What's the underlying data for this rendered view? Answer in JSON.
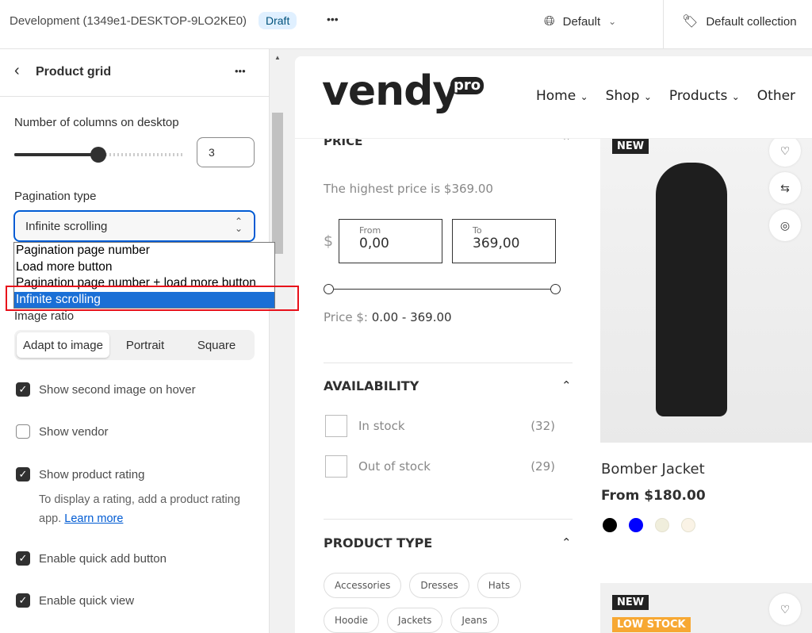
{
  "topbar": {
    "title": "Development (1349e1-DESKTOP-9LO2KE0)",
    "badge": "Draft",
    "more": "•••",
    "language": "Default",
    "collection": "Default collection"
  },
  "panel": {
    "back": "‹",
    "title": "Product grid",
    "more": "•••",
    "columns_label": "Number of columns on desktop",
    "columns_value": "3",
    "columns_fraction": 0.5,
    "pagination_label": "Pagination type",
    "pagination_value": "Infinite scrolling",
    "options": [
      "Pagination page number",
      "Load more button",
      "Pagination page number + load more button",
      "Infinite scrolling"
    ],
    "image_ratio_label": "Image ratio",
    "image_ratio_options": [
      "Adapt to image",
      "Portrait",
      "Square"
    ],
    "checks": [
      {
        "label": "Show second image on hover",
        "checked": true
      },
      {
        "label": "Show vendor",
        "checked": false
      },
      {
        "label": "Show product rating",
        "checked": true
      },
      {
        "label": "Enable quick add button",
        "checked": true
      },
      {
        "label": "Enable quick view",
        "checked": true
      }
    ],
    "rating_help": "To display a rating, add a product rating app.",
    "learn_more": "Learn more"
  },
  "store": {
    "logo": "vendy",
    "logo_sup": "pro",
    "nav": [
      "Home",
      "Shop",
      "Products",
      "Other"
    ],
    "price": {
      "heading": "PRICE",
      "highest": "The highest price is $369.00",
      "currency": "$",
      "from_label": "From",
      "from_value": "0,00",
      "to_label": "To",
      "to_value": "369,00",
      "range_label": "Price $:",
      "range_value": "0.00 - 369.00"
    },
    "availability": {
      "heading": "AVAILABILITY",
      "items": [
        {
          "label": "In stock",
          "count": "(32)"
        },
        {
          "label": "Out of stock",
          "count": "(29)"
        }
      ]
    },
    "product_type": {
      "heading": "PRODUCT TYPE",
      "chips": [
        "Accessories",
        "Dresses",
        "Hats",
        "Hoodie",
        "Jackets",
        "Jeans"
      ]
    },
    "product": {
      "badge": "NEW",
      "name": "Bomber Jacket",
      "price": "From $180.00",
      "swatches": [
        "#000000",
        "#0000ff",
        "#f0eedc",
        "#faf3e6"
      ]
    },
    "product2": {
      "badge": "NEW",
      "badge2": "LOW STOCK"
    }
  }
}
